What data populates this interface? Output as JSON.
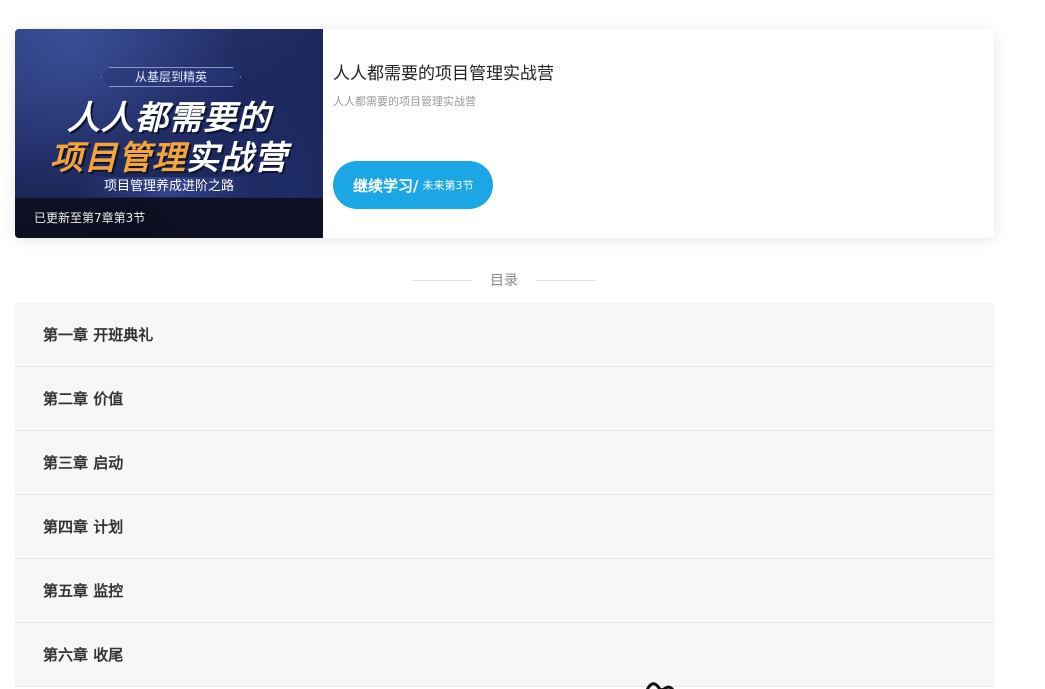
{
  "course": {
    "cover": {
      "tag": "从基层到精英",
      "title_line1": "人人都需要的",
      "title_line2_orange": "项目管理",
      "title_line2_white": "实战营",
      "subtitle": "项目管理养成进阶之路",
      "update_status": "已更新至第7章第3节"
    },
    "title": "人人都需要的项目管理实战营",
    "description": "人人都需要的项目管理实战营",
    "continue_button": {
      "label": "继续学习/",
      "sub_label": "未来第3节"
    }
  },
  "toc": {
    "heading": "目录",
    "chapters": [
      {
        "label": "第一章 开班典礼"
      },
      {
        "label": "第二章 价值"
      },
      {
        "label": "第三章 启动"
      },
      {
        "label": "第四章 计划"
      },
      {
        "label": "第五章 监控"
      },
      {
        "label": "第六章 收尾"
      }
    ]
  },
  "colors": {
    "accent": "#1ba6e6",
    "cover_orange": "#f4a53a",
    "chapter_bg": "#f7f7f7"
  }
}
